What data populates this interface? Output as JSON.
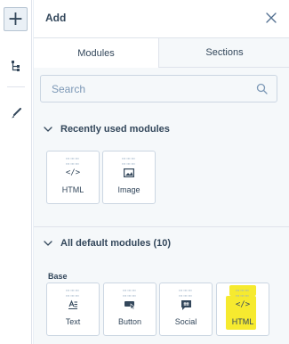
{
  "rail": {
    "add_icon": "plus-icon",
    "tree_icon": "tree-icon",
    "brush_icon": "brush-icon"
  },
  "panel": {
    "title": "Add",
    "close_icon": "close-icon"
  },
  "tabs": [
    {
      "label": "Modules",
      "active": true
    },
    {
      "label": "Sections",
      "active": false
    }
  ],
  "search": {
    "placeholder": "Search",
    "value": ""
  },
  "recent": {
    "title": "Recently used modules",
    "items": [
      {
        "label": "HTML",
        "icon": "code-icon"
      },
      {
        "label": "Image",
        "icon": "image-icon"
      }
    ]
  },
  "all": {
    "title": "All default modules (10)",
    "group_label": "Base",
    "items": [
      {
        "label": "Text",
        "icon": "text-icon"
      },
      {
        "label": "Button",
        "icon": "button-icon"
      },
      {
        "label": "Social",
        "icon": "social-icon"
      },
      {
        "label": "HTML",
        "icon": "code-icon",
        "highlighted": true
      }
    ]
  },
  "colors": {
    "text": "#33475b",
    "border": "#cbd6e2",
    "panel_bg": "#f5f8fa",
    "highlight": "#f5e60a"
  }
}
